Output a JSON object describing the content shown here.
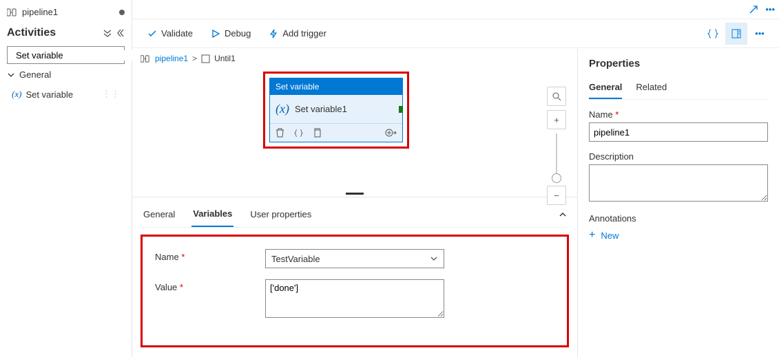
{
  "tab": {
    "title": "pipeline1"
  },
  "activities": {
    "title": "Activities",
    "search_value": "Set variable",
    "category": "General",
    "item_label": "Set variable"
  },
  "toolbar": {
    "validate": "Validate",
    "debug": "Debug",
    "add_trigger": "Add trigger"
  },
  "breadcrumb": {
    "root": "pipeline1",
    "child": "Until1"
  },
  "node": {
    "type_label": "Set variable",
    "title": "Set variable1"
  },
  "bottom_tabs": {
    "general": "General",
    "variables": "Variables",
    "user_props": "User properties"
  },
  "var_form": {
    "name_label": "Name",
    "name_value": "TestVariable",
    "value_label": "Value",
    "value_value": "['done']"
  },
  "props": {
    "title": "Properties",
    "tabs": {
      "general": "General",
      "related": "Related"
    },
    "name_label": "Name",
    "name_value": "pipeline1",
    "desc_label": "Description",
    "desc_value": "",
    "ann_label": "Annotations",
    "new_label": "New"
  }
}
